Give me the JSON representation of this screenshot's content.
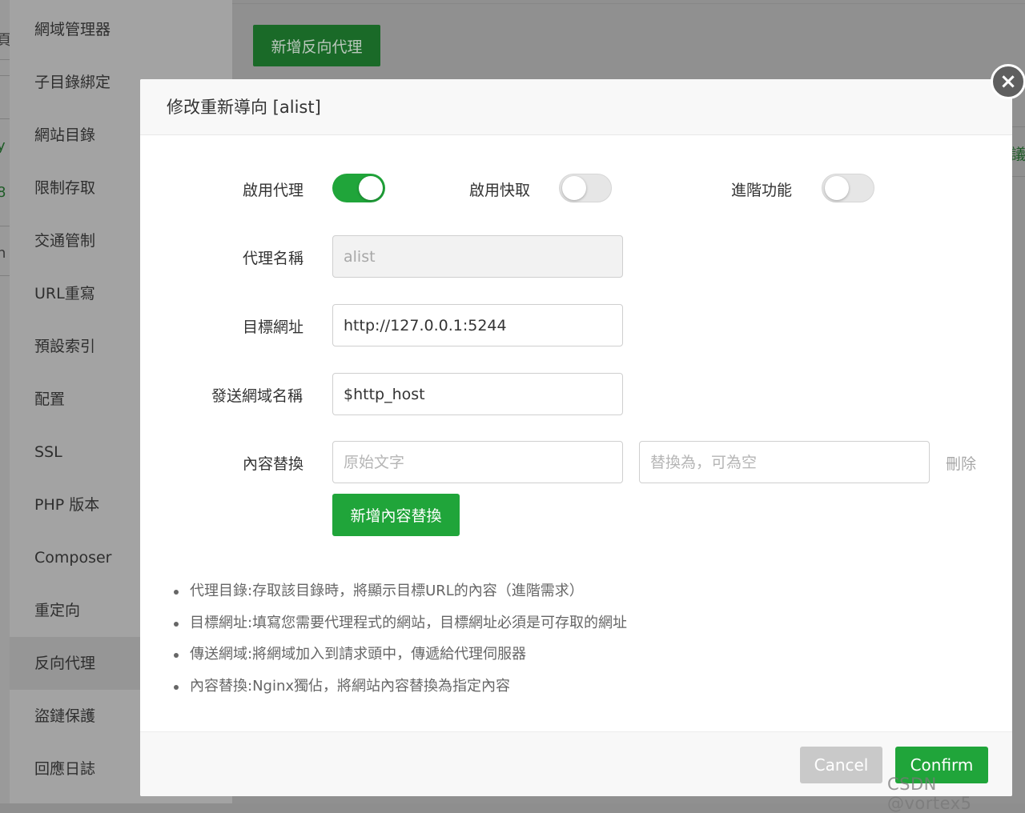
{
  "background": {
    "edge_fragments": [
      "頁",
      "y",
      "8",
      "h"
    ],
    "sidebar_items": [
      {
        "label": "網域管理器"
      },
      {
        "label": "子目錄綁定"
      },
      {
        "label": "網站目錄"
      },
      {
        "label": "限制存取"
      },
      {
        "label": "交通管制"
      },
      {
        "label": "URL重寫"
      },
      {
        "label": "預設索引"
      },
      {
        "label": "配置"
      },
      {
        "label": "SSL"
      },
      {
        "label": "PHP 版本"
      },
      {
        "label": "Composer"
      },
      {
        "label": "重定向"
      },
      {
        "label": "反向代理",
        "active": true
      },
      {
        "label": "盜鏈保護"
      },
      {
        "label": "回應日誌"
      }
    ],
    "add_proxy_button": "新增反向代理",
    "right_fragment": "議"
  },
  "modal": {
    "title": "修改重新導向 [alist]",
    "close_icon": "×",
    "toggles": {
      "enable_proxy": {
        "label": "啟用代理",
        "on": true
      },
      "enable_cache": {
        "label": "啟用快取",
        "on": false
      },
      "advanced": {
        "label": "進階功能",
        "on": false
      }
    },
    "proxy_name": {
      "label": "代理名稱",
      "value": "alist"
    },
    "target_url": {
      "label": "目標網址",
      "value": "http://127.0.0.1:5244"
    },
    "send_domain": {
      "label": "發送網域名稱",
      "value": "$http_host"
    },
    "content_replace": {
      "label": "內容替換",
      "original_placeholder": "原始文字",
      "replacement_placeholder": "替換為，可為空",
      "delete_label": "刪除",
      "add_button": "新增內容替換"
    },
    "notes": [
      "代理目錄:存取該目錄時，將顯示目標URL的內容（進階需求）",
      "目標網址:填寫您需要代理程式的網站，目標網址必須是可存取的網址",
      "傳送網域:將網域加入到請求頭中，傳遞給代理伺服器",
      "內容替換:Nginx獨佔，將網站內容替換為指定內容"
    ],
    "footer": {
      "cancel_label": "Cancel",
      "confirm_label": "Confirm"
    }
  },
  "colors": {
    "accent": "#20a53a",
    "disabled_button": "#c9c9c9"
  },
  "watermark": "CSDN @vortex5"
}
